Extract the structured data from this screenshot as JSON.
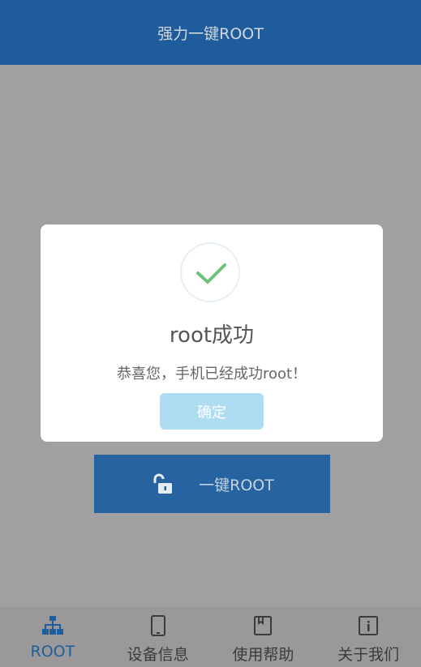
{
  "header": {
    "title": "强力一键ROOT"
  },
  "main": {
    "action_label": "一键ROOT",
    "action_icon": "unlock-icon"
  },
  "dialog": {
    "icon": "checkmark-icon",
    "title": "root成功",
    "message": "恭喜您，手机已经成功root！",
    "confirm_label": "确定"
  },
  "tabs": [
    {
      "label": "ROOT",
      "icon": "network-tree-icon",
      "active": true
    },
    {
      "label": "设备信息",
      "icon": "phone-icon",
      "active": false
    },
    {
      "label": "使用帮助",
      "icon": "book-icon",
      "active": false
    },
    {
      "label": "关于我们",
      "icon": "info-icon",
      "active": false
    }
  ],
  "colors": {
    "header": "#1e5c9b",
    "accent": "#1f5e9c",
    "success": "#6dc27a",
    "confirm_button": "#aedcf1"
  }
}
